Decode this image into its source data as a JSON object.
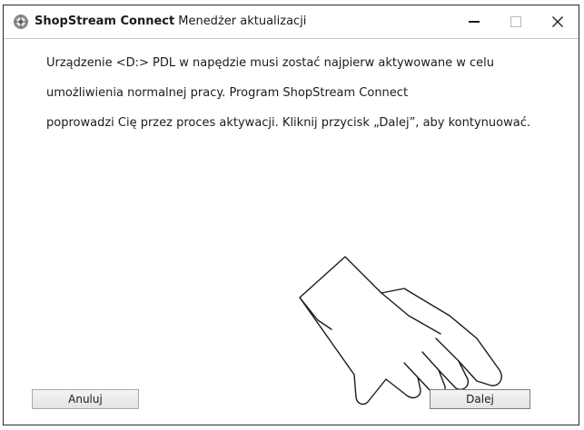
{
  "window": {
    "app_name": "ShopStream Connect",
    "title_rest": "Menedżer aktualizacji",
    "controls": {
      "minimize_icon": "minimize-icon",
      "maximize_icon": "maximize-icon",
      "close_icon": "close-icon"
    }
  },
  "message": {
    "lines": [
      "Urządzenie <D:> PDL w napędzie musi zostać najpierw aktywowane w celu",
      "umożliwienia normalnej pracy. Program ShopStream Connect",
      "poprowadzi Cię przez proces aktywacji. Kliknij przycisk „Dalej”, aby kontynuować."
    ]
  },
  "buttons": {
    "cancel_label": "Anuluj",
    "next_label": "Dalej"
  },
  "illustration": {
    "icon": "pointing-hand-icon"
  }
}
